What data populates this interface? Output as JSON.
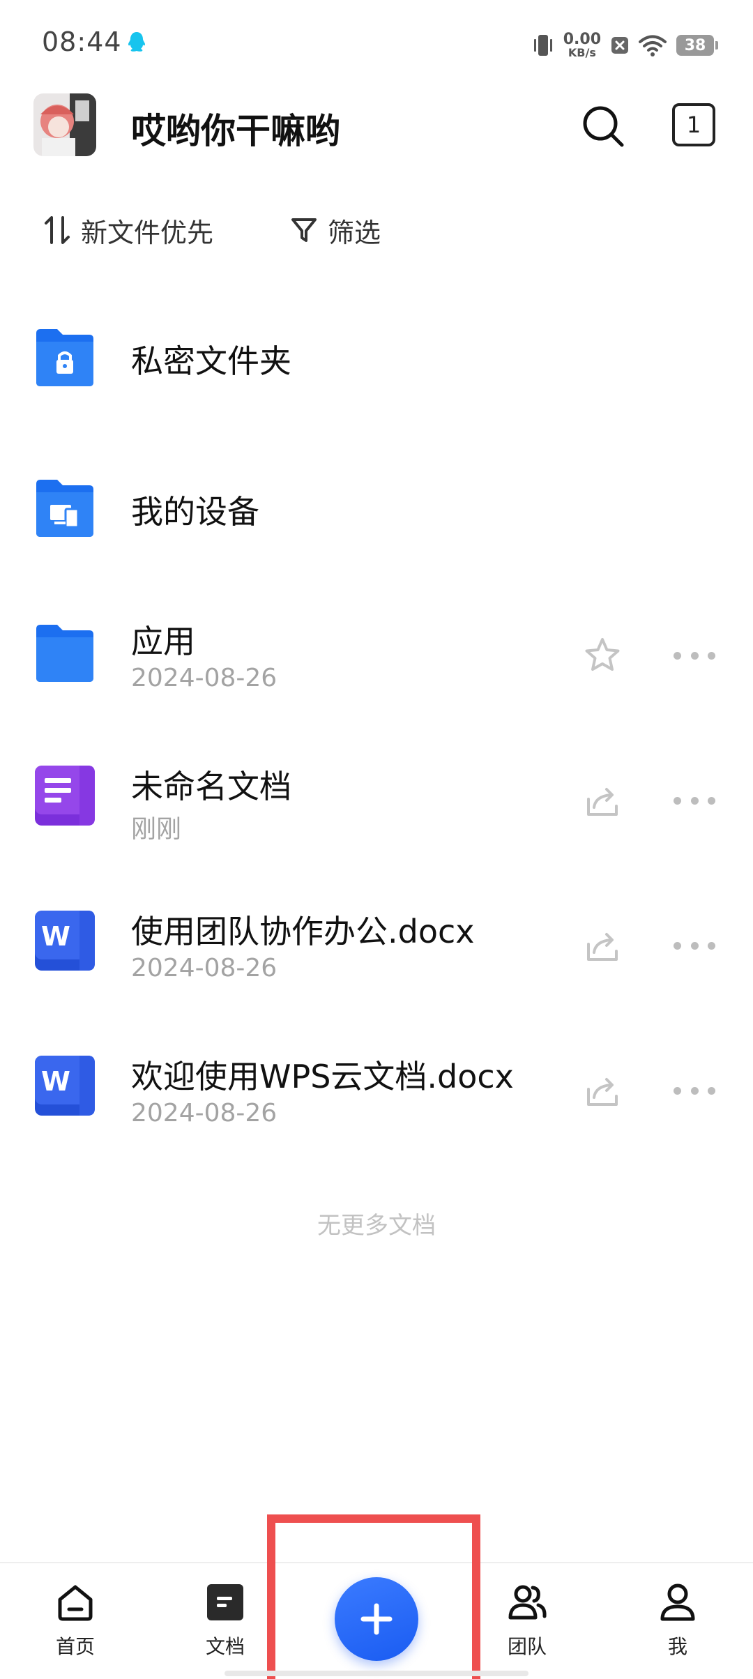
{
  "status_bar": {
    "time": "08:44",
    "net_speed_value": "0.00",
    "net_speed_unit": "KB/s",
    "battery": "38"
  },
  "header": {
    "user_name": "哎哟你干嘛哟",
    "tab_count": "1"
  },
  "toolbar": {
    "sort_label": "新文件优先",
    "filter_label": "筛选"
  },
  "files": [
    {
      "name": "私密文件夹",
      "date": "",
      "icon": "private-folder-icon"
    },
    {
      "name": "我的设备",
      "date": "",
      "icon": "device-folder-icon"
    },
    {
      "name": "应用",
      "date": "2024-08-26",
      "icon": "folder-icon",
      "action": "star-icon"
    },
    {
      "name": "未命名文档",
      "date": "刚刚",
      "icon": "document-icon",
      "action": "share-icon"
    },
    {
      "name": "使用团队协作办公.docx",
      "date": "2024-08-26",
      "icon": "word-icon",
      "action": "share-icon"
    },
    {
      "name": "欢迎使用WPS云文档.docx",
      "date": "2024-08-26",
      "icon": "word-icon",
      "action": "share-icon"
    }
  ],
  "word_icon_letter": "W",
  "end_hint": "无更多文档",
  "bottom_nav": {
    "items": [
      {
        "label": "首页",
        "icon": "home-icon"
      },
      {
        "label": "文档",
        "icon": "document-nav-icon"
      },
      {
        "label": "团队",
        "icon": "team-icon"
      },
      {
        "label": "我",
        "icon": "person-icon"
      }
    ],
    "fab_icon": "plus-icon"
  },
  "colors": {
    "accent_blue": "#1a6ff0",
    "word_blue": "#2d5be6",
    "doc_purple": "#8a3ee0",
    "highlight_red": "#ee4f4f"
  }
}
